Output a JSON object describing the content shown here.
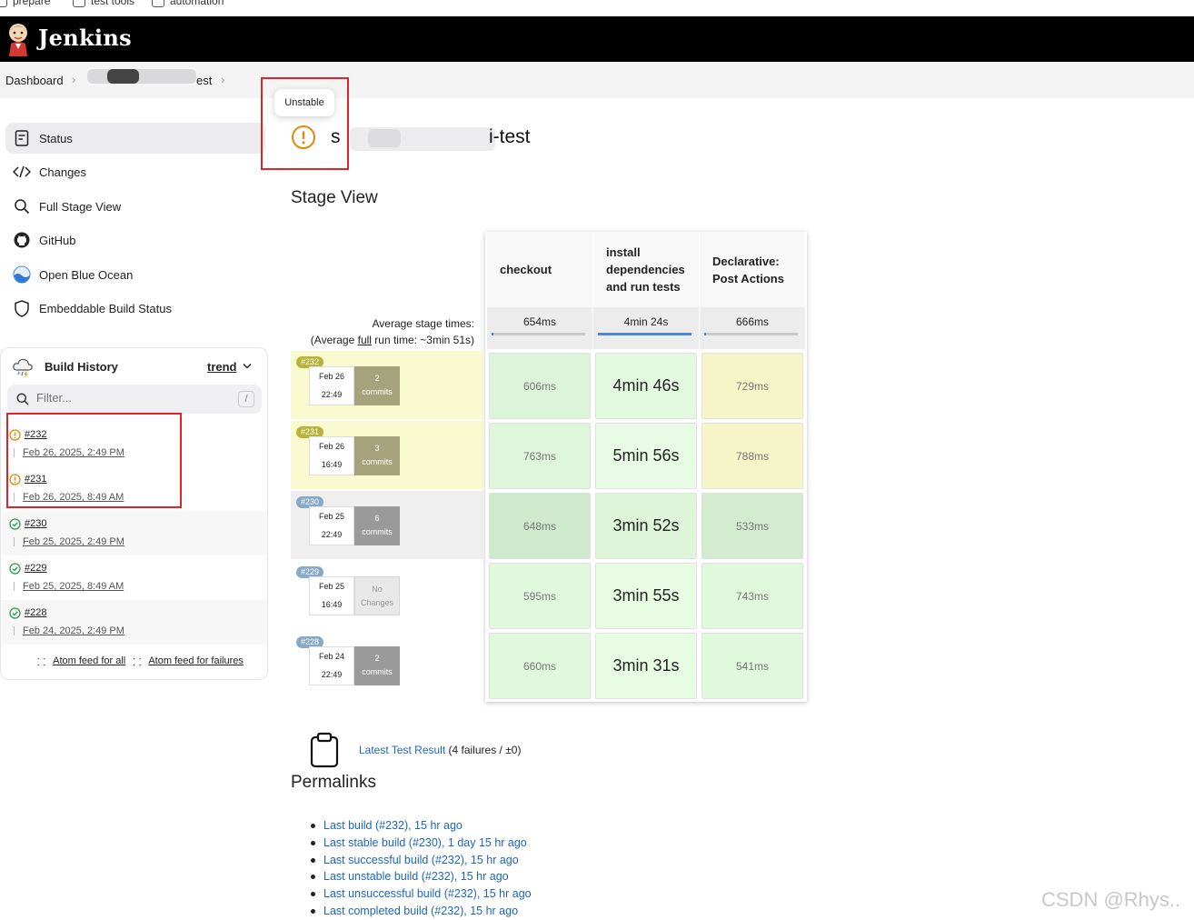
{
  "bookmarks": [
    {
      "label": "prepare"
    },
    {
      "label": "test tools"
    },
    {
      "label": "automation"
    }
  ],
  "header": {
    "brand": "Jenkins"
  },
  "breadcrumb": {
    "dashboard": "Dashboard",
    "job_suffix": "est"
  },
  "tooltip": {
    "text": "Unstable"
  },
  "job": {
    "title_start": "s",
    "title_end": "i-test",
    "status": "unstable"
  },
  "sidebar": {
    "items": [
      {
        "label": "Status",
        "icon": "document-icon"
      },
      {
        "label": "Changes",
        "icon": "code-icon"
      },
      {
        "label": "Full Stage View",
        "icon": "search-icon"
      },
      {
        "label": "GitHub",
        "icon": "github-icon"
      },
      {
        "label": "Open Blue Ocean",
        "icon": "blue-ocean-icon"
      },
      {
        "label": "Embeddable Build Status",
        "icon": "shield-icon"
      }
    ]
  },
  "build_history": {
    "title": "Build History",
    "trend": "trend",
    "filter_placeholder": "Filter...",
    "filter_shortcut": "/",
    "builds": [
      {
        "num": "#232",
        "date": "Feb 26, 2025, 2:49 PM",
        "status": "unstable"
      },
      {
        "num": "#231",
        "date": "Feb 26, 2025, 8:49 AM",
        "status": "unstable"
      },
      {
        "num": "#230",
        "date": "Feb 25, 2025, 2:49 PM",
        "status": "success"
      },
      {
        "num": "#229",
        "date": "Feb 25, 2025, 8:49 AM",
        "status": "success"
      },
      {
        "num": "#228",
        "date": "Feb 24, 2025, 2:49 PM",
        "status": "success"
      }
    ],
    "feed_all": "Atom feed for all",
    "feed_failures": "Atom feed for failures"
  },
  "stage_view": {
    "title": "Stage View",
    "avg_label_1": "Average stage times:",
    "avg_label_2_pre": "(Average ",
    "avg_label_2_full": "full",
    "avg_label_2_post": " run time: ~3min 51s)",
    "stages": [
      {
        "name": "checkout",
        "avg": "654ms",
        "avg_fill": 0.02
      },
      {
        "name": "install dependencies and run tests",
        "avg": "4min 24s",
        "avg_fill": 1.0
      },
      {
        "name": "Declarative: Post Actions",
        "avg": "666ms",
        "avg_fill": 0.02
      }
    ],
    "runs": [
      {
        "badge": "#232",
        "date": "Feb 26",
        "time": "22:49",
        "commits_n": "2",
        "commits_label": "commits",
        "status": "unstable",
        "times": [
          "606ms",
          "4min 46s",
          "729ms"
        ]
      },
      {
        "badge": "#231",
        "date": "Feb 26",
        "time": "16:49",
        "commits_n": "3",
        "commits_label": "commits",
        "status": "unstable",
        "times": [
          "763ms",
          "5min 56s",
          "788ms"
        ]
      },
      {
        "badge": "#230",
        "date": "Feb 25",
        "time": "22:49",
        "commits_n": "6",
        "commits_label": "commits",
        "status": "success",
        "times": [
          "648ms",
          "3min 52s",
          "533ms"
        ]
      },
      {
        "badge": "#229",
        "date": "Feb 25",
        "time": "16:49",
        "commits_n": "No",
        "commits_label": "Changes",
        "status": "success",
        "times": [
          "595ms",
          "3min 55s",
          "743ms"
        ]
      },
      {
        "badge": "#228",
        "date": "Feb 24",
        "time": "22:49",
        "commits_n": "2",
        "commits_label": "commits",
        "status": "success",
        "times": [
          "660ms",
          "3min 31s",
          "541ms"
        ]
      }
    ]
  },
  "test_result": {
    "link": "Latest Test Result",
    "detail": " (4 failures / ±0)"
  },
  "permalinks": {
    "title": "Permalinks",
    "items": [
      "Last build (#232), 15 hr ago",
      "Last stable build (#230), 1 day 15 hr ago",
      "Last successful build (#232), 15 hr ago",
      "Last unstable build (#232), 15 hr ago",
      "Last unsuccessful build (#232), 15 hr ago",
      "Last completed build (#232), 15 hr ago"
    ]
  },
  "watermark": "CSDN @Rhys..",
  "colors": {
    "unstable": "#e08a0b",
    "success": "#2e9e4e",
    "link": "#1d65c1",
    "highlight_box": "#e0242e"
  }
}
